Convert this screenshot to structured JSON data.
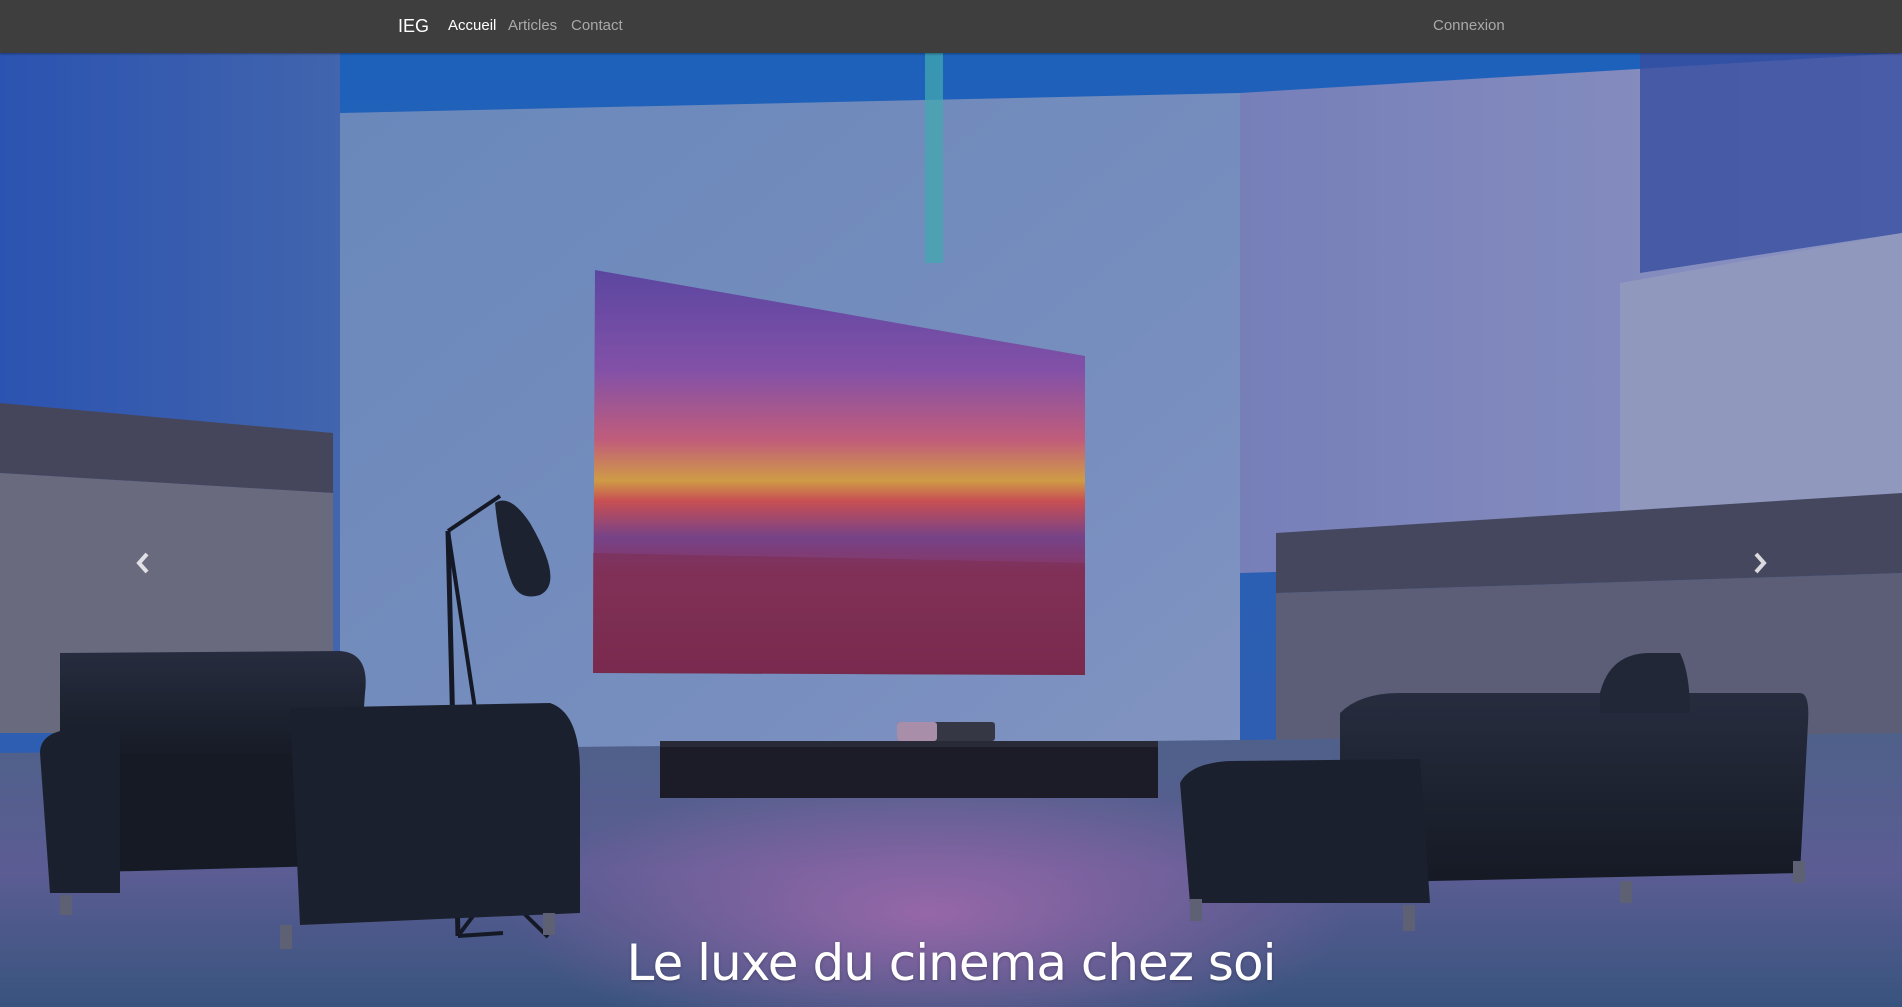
{
  "navbar": {
    "brand": "IEG",
    "links": [
      {
        "label": "Accueil",
        "active": true
      },
      {
        "label": "Articles",
        "active": false
      },
      {
        "label": "Contact",
        "active": false
      }
    ],
    "right_link": "Connexion"
  },
  "carousel": {
    "caption": "Le luxe du cinema chez soi",
    "slide_count": 3,
    "active_slide_index": 1,
    "prev_icon": "chevron-left-icon",
    "next_icon": "chevron-right-icon"
  },
  "colors": {
    "navbar_bg": "#3e3e3e",
    "nav_active": "#ffffff",
    "nav_inactive": "#a9a9a9"
  }
}
